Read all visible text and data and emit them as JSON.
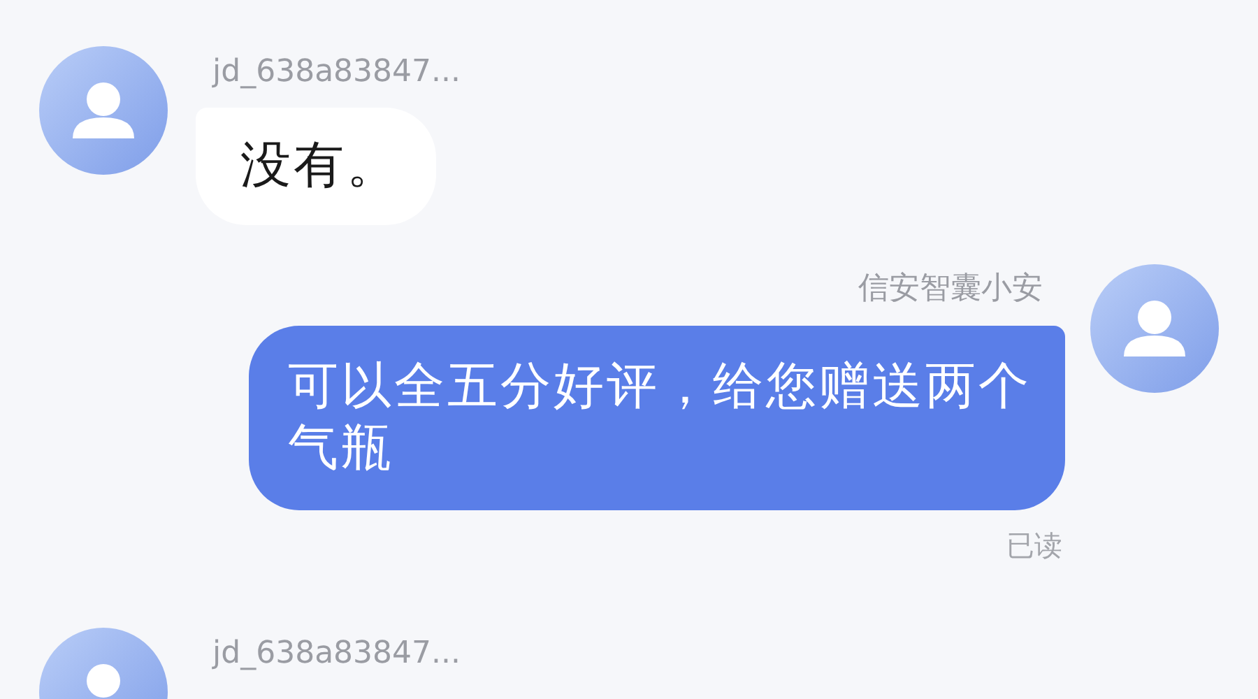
{
  "messages": [
    {
      "kind": "incoming",
      "sender": "jd_638a83847...",
      "text": "没有。"
    },
    {
      "kind": "outgoing",
      "sender": "信安智囊小安",
      "text": "可以全五分好评，给您赠送两个气瓶",
      "status": "已读"
    },
    {
      "kind": "incoming",
      "sender": "jd_638a83847..."
    }
  ]
}
